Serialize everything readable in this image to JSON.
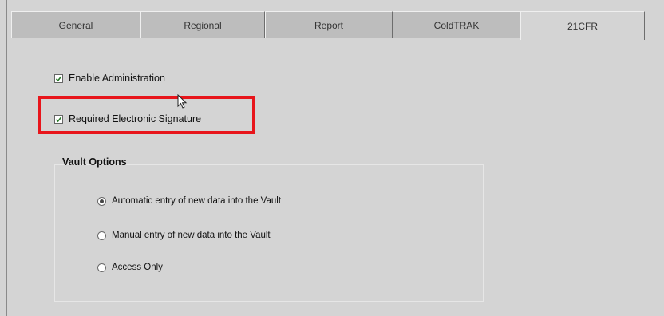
{
  "tabs": [
    {
      "label": "General",
      "active": false
    },
    {
      "label": "Regional",
      "active": false
    },
    {
      "label": "Report",
      "active": false
    },
    {
      "label": "ColdTRAK",
      "active": false
    },
    {
      "label": "21CFR",
      "active": true
    }
  ],
  "checkboxes": {
    "enable_administration": {
      "label": "Enable Administration",
      "checked": true
    },
    "required_signature": {
      "label": "Required Electronic Signature",
      "checked": true
    }
  },
  "vault": {
    "title": "Vault Options",
    "options": [
      {
        "label": "Automatic entry of new data into the Vault",
        "selected": true
      },
      {
        "label": "Manual entry of new data into the Vault",
        "selected": false
      },
      {
        "label": "Access Only",
        "selected": false
      }
    ]
  },
  "colors": {
    "highlight": "#e8151b",
    "check": "#2a7a2a"
  }
}
